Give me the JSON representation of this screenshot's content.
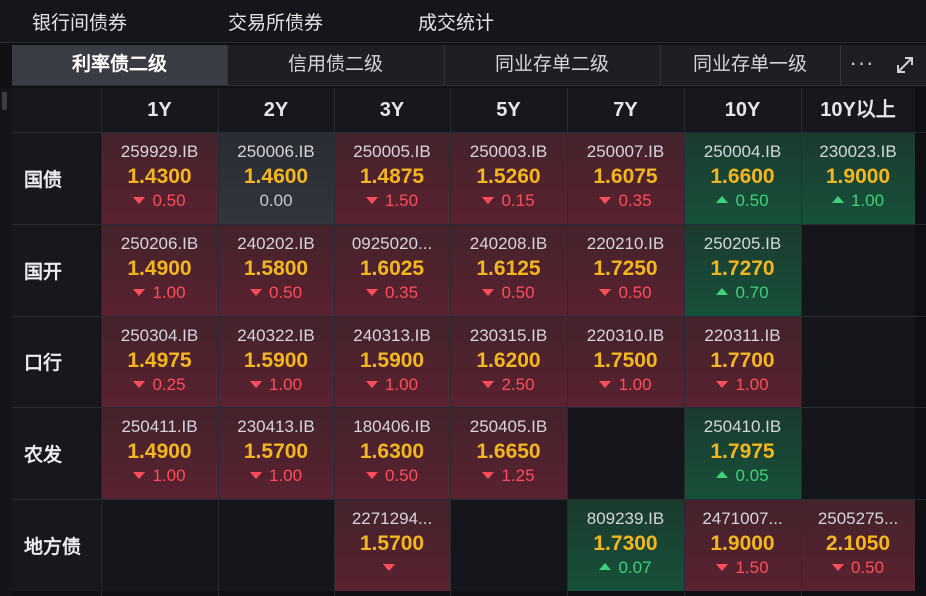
{
  "top_nav": [
    "银行间债券",
    "交易所债券",
    "成交统计"
  ],
  "tabs": [
    {
      "label": "利率债二级",
      "active": true
    },
    {
      "label": "信用债二级",
      "active": false
    },
    {
      "label": "同业存单二级",
      "active": false
    },
    {
      "label": "同业存单一级",
      "active": false
    }
  ],
  "more_label": "···",
  "columns": [
    "1Y",
    "2Y",
    "3Y",
    "5Y",
    "7Y",
    "10Y",
    "10Y以上"
  ],
  "rows": [
    {
      "label": "国债",
      "cells": [
        {
          "code": "259929.IB",
          "rate": "1.4300",
          "chg": "0.50",
          "dir": "down"
        },
        {
          "code": "250006.IB",
          "rate": "1.4600",
          "chg": "0.00",
          "dir": "flat"
        },
        {
          "code": "250005.IB",
          "rate": "1.4875",
          "chg": "1.50",
          "dir": "down"
        },
        {
          "code": "250003.IB",
          "rate": "1.5260",
          "chg": "0.15",
          "dir": "down"
        },
        {
          "code": "250007.IB",
          "rate": "1.6075",
          "chg": "0.35",
          "dir": "down"
        },
        {
          "code": "250004.IB",
          "rate": "1.6600",
          "chg": "0.50",
          "dir": "up"
        },
        {
          "code": "230023.IB",
          "rate": "1.9000",
          "chg": "1.00",
          "dir": "up"
        }
      ]
    },
    {
      "label": "国开",
      "cells": [
        {
          "code": "250206.IB",
          "rate": "1.4900",
          "chg": "1.00",
          "dir": "down"
        },
        {
          "code": "240202.IB",
          "rate": "1.5800",
          "chg": "0.50",
          "dir": "down"
        },
        {
          "code": "0925020...",
          "rate": "1.6025",
          "chg": "0.35",
          "dir": "down"
        },
        {
          "code": "240208.IB",
          "rate": "1.6125",
          "chg": "0.50",
          "dir": "down"
        },
        {
          "code": "220210.IB",
          "rate": "1.7250",
          "chg": "0.50",
          "dir": "down"
        },
        {
          "code": "250205.IB",
          "rate": "1.7270",
          "chg": "0.70",
          "dir": "up"
        },
        null
      ]
    },
    {
      "label": "口行",
      "cells": [
        {
          "code": "250304.IB",
          "rate": "1.4975",
          "chg": "0.25",
          "dir": "down"
        },
        {
          "code": "240322.IB",
          "rate": "1.5900",
          "chg": "1.00",
          "dir": "down"
        },
        {
          "code": "240313.IB",
          "rate": "1.5900",
          "chg": "1.00",
          "dir": "down"
        },
        {
          "code": "230315.IB",
          "rate": "1.6200",
          "chg": "2.50",
          "dir": "down"
        },
        {
          "code": "220310.IB",
          "rate": "1.7500",
          "chg": "1.00",
          "dir": "down"
        },
        {
          "code": "220311.IB",
          "rate": "1.7700",
          "chg": "1.00",
          "dir": "down"
        },
        null
      ]
    },
    {
      "label": "农发",
      "cells": [
        {
          "code": "250411.IB",
          "rate": "1.4900",
          "chg": "1.00",
          "dir": "down"
        },
        {
          "code": "230413.IB",
          "rate": "1.5700",
          "chg": "1.00",
          "dir": "down"
        },
        {
          "code": "180406.IB",
          "rate": "1.6300",
          "chg": "0.50",
          "dir": "down"
        },
        {
          "code": "250405.IB",
          "rate": "1.6650",
          "chg": "1.25",
          "dir": "down"
        },
        null,
        {
          "code": "250410.IB",
          "rate": "1.7975",
          "chg": "0.05",
          "dir": "up"
        },
        null
      ]
    },
    {
      "label": "地方债",
      "cells": [
        null,
        null,
        {
          "code": "2271294...",
          "rate": "1.5700",
          "chg": "",
          "dir": "down"
        },
        null,
        {
          "code": "809239.IB",
          "rate": "1.7300",
          "chg": "0.07",
          "dir": "up"
        },
        {
          "code": "2471007...",
          "rate": "1.9000",
          "chg": "1.50",
          "dir": "down"
        },
        {
          "code": "2505275...",
          "rate": "2.1050",
          "chg": "0.50",
          "dir": "down"
        }
      ]
    }
  ],
  "colors": {
    "up": "#3fd27a",
    "down": "#ff4d5a",
    "rate": "#f3b61f"
  },
  "icons": {
    "more": "more-horizontal-icon",
    "expand": "expand-icon"
  }
}
